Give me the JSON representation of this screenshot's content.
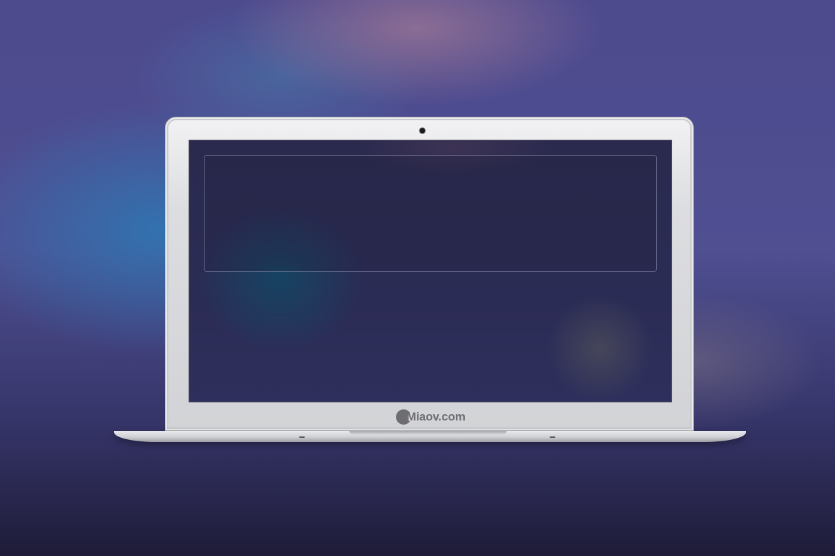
{
  "laptop": {
    "brand_text": "Miaov.com",
    "brand_icon": "miaov-logo-icon",
    "camera_icon": "webcam-icon"
  },
  "colors": {
    "background_top": "#4d4a8e",
    "background_bottom": "#1e1c38",
    "screen": "#2b2c55",
    "bezel": "#dcdde0",
    "brand": "#6e6e72"
  }
}
